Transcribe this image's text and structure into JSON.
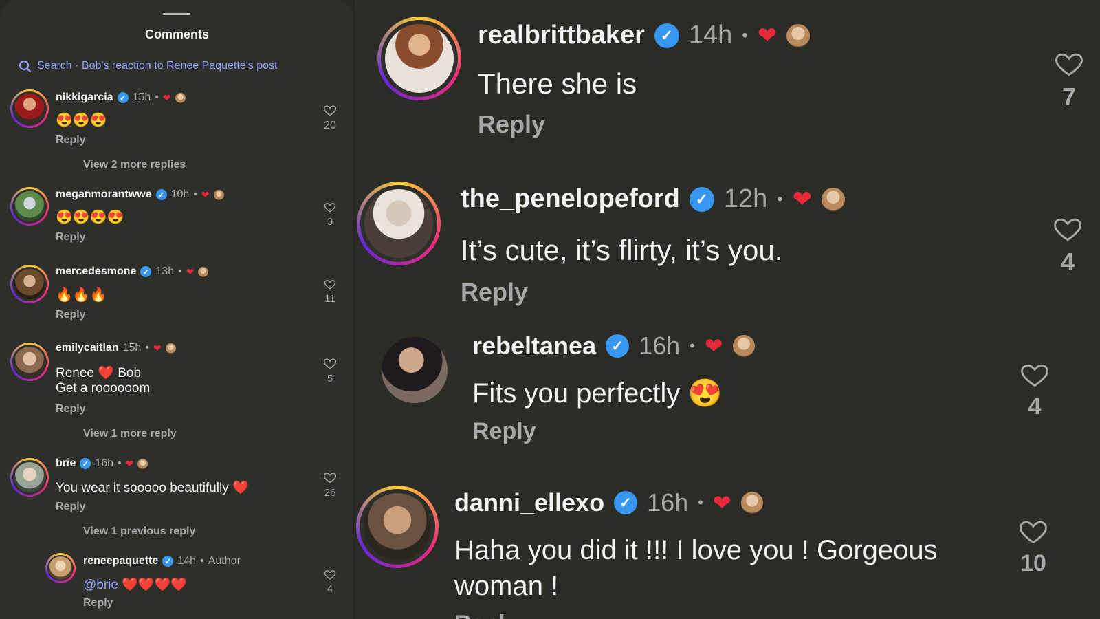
{
  "panel": {
    "title": "Comments",
    "search_text": "Search · Bob's reaction to Renee Paquette's post"
  },
  "left_comments": [
    {
      "user": "nikkigarcia",
      "time": "15h",
      "text": "😍😍😍",
      "reply": "Reply",
      "likes": "20",
      "more": "View 2 more replies"
    },
    {
      "user": "meganmorantwwe",
      "time": "10h",
      "text": "😍😍😍😍",
      "reply": "Reply",
      "likes": "3"
    },
    {
      "user": "mercedesmone",
      "time": "13h",
      "text": "🔥🔥🔥",
      "reply": "Reply",
      "likes": "11"
    },
    {
      "user": "emilycaitlan",
      "time": "15h",
      "text_line1": "Renee ❤️ Bob",
      "text_line2": "Get a roooooom",
      "reply": "Reply",
      "likes": "5",
      "more": "View 1 more reply"
    },
    {
      "user": "brie",
      "time": "16h",
      "text": "You wear it sooooo beautifully ❤️",
      "reply": "Reply",
      "likes": "26",
      "more": "View 1 previous reply"
    },
    {
      "user": "reneepaquette",
      "time": "14h",
      "author": "Author",
      "mention": "@brie",
      "text": "❤️❤️❤️❤️",
      "reply": "Reply",
      "likes": "4"
    }
  ],
  "right_comments": [
    {
      "user": "realbrittbaker",
      "time": "14h",
      "text": "There she is",
      "reply": "Reply",
      "likes": "7"
    },
    {
      "user": "the_penelopeford",
      "time": "12h",
      "text": "It’s cute, it’s flirty, it’s you.",
      "reply": "Reply",
      "likes": "4"
    },
    {
      "user": "rebeltanea",
      "time": "16h",
      "text": "Fits you perfectly 😍",
      "reply": "Reply",
      "likes": "4"
    },
    {
      "user": "danni_ellexo",
      "time": "16h",
      "text_line1": "Haha you did it !!! I love you ! Gorgeous",
      "text_line2": "woman !",
      "reply": "Reply",
      "likes": "10"
    }
  ],
  "colors": {
    "verified": "#3897f0",
    "heart": "#e8283b",
    "link": "#9aa0ff",
    "muted": "#a8a8a8"
  },
  "icons": {
    "search": "search-icon",
    "like": "heart-outline-icon",
    "verified": "verified-badge-icon"
  }
}
